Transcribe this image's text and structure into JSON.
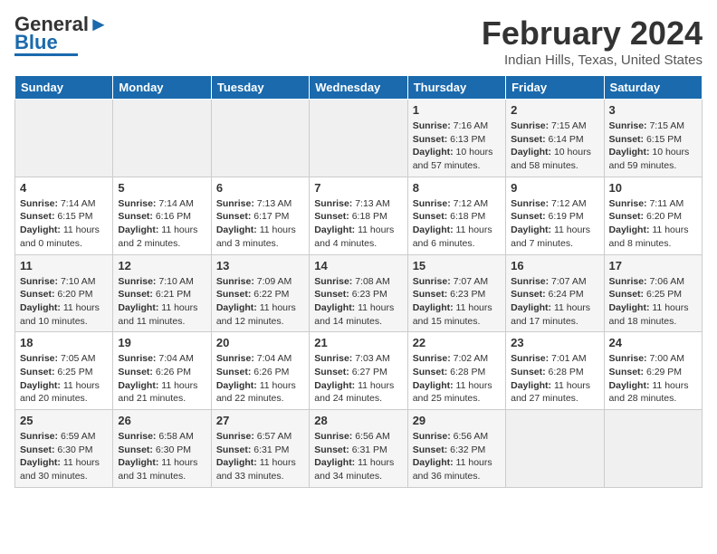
{
  "header": {
    "logo_text_general": "General",
    "logo_text_blue": "Blue",
    "title": "February 2024",
    "subtitle": "Indian Hills, Texas, United States"
  },
  "calendar": {
    "days_of_week": [
      "Sunday",
      "Monday",
      "Tuesday",
      "Wednesday",
      "Thursday",
      "Friday",
      "Saturday"
    ],
    "weeks": [
      [
        {
          "day": "",
          "content": ""
        },
        {
          "day": "",
          "content": ""
        },
        {
          "day": "",
          "content": ""
        },
        {
          "day": "",
          "content": ""
        },
        {
          "day": "1",
          "content": "Sunrise: 7:16 AM\nSunset: 6:13 PM\nDaylight: 10 hours and 57 minutes."
        },
        {
          "day": "2",
          "content": "Sunrise: 7:15 AM\nSunset: 6:14 PM\nDaylight: 10 hours and 58 minutes."
        },
        {
          "day": "3",
          "content": "Sunrise: 7:15 AM\nSunset: 6:15 PM\nDaylight: 10 hours and 59 minutes."
        }
      ],
      [
        {
          "day": "4",
          "content": "Sunrise: 7:14 AM\nSunset: 6:15 PM\nDaylight: 11 hours and 0 minutes."
        },
        {
          "day": "5",
          "content": "Sunrise: 7:14 AM\nSunset: 6:16 PM\nDaylight: 11 hours and 2 minutes."
        },
        {
          "day": "6",
          "content": "Sunrise: 7:13 AM\nSunset: 6:17 PM\nDaylight: 11 hours and 3 minutes."
        },
        {
          "day": "7",
          "content": "Sunrise: 7:13 AM\nSunset: 6:18 PM\nDaylight: 11 hours and 4 minutes."
        },
        {
          "day": "8",
          "content": "Sunrise: 7:12 AM\nSunset: 6:18 PM\nDaylight: 11 hours and 6 minutes."
        },
        {
          "day": "9",
          "content": "Sunrise: 7:12 AM\nSunset: 6:19 PM\nDaylight: 11 hours and 7 minutes."
        },
        {
          "day": "10",
          "content": "Sunrise: 7:11 AM\nSunset: 6:20 PM\nDaylight: 11 hours and 8 minutes."
        }
      ],
      [
        {
          "day": "11",
          "content": "Sunrise: 7:10 AM\nSunset: 6:20 PM\nDaylight: 11 hours and 10 minutes."
        },
        {
          "day": "12",
          "content": "Sunrise: 7:10 AM\nSunset: 6:21 PM\nDaylight: 11 hours and 11 minutes."
        },
        {
          "day": "13",
          "content": "Sunrise: 7:09 AM\nSunset: 6:22 PM\nDaylight: 11 hours and 12 minutes."
        },
        {
          "day": "14",
          "content": "Sunrise: 7:08 AM\nSunset: 6:23 PM\nDaylight: 11 hours and 14 minutes."
        },
        {
          "day": "15",
          "content": "Sunrise: 7:07 AM\nSunset: 6:23 PM\nDaylight: 11 hours and 15 minutes."
        },
        {
          "day": "16",
          "content": "Sunrise: 7:07 AM\nSunset: 6:24 PM\nDaylight: 11 hours and 17 minutes."
        },
        {
          "day": "17",
          "content": "Sunrise: 7:06 AM\nSunset: 6:25 PM\nDaylight: 11 hours and 18 minutes."
        }
      ],
      [
        {
          "day": "18",
          "content": "Sunrise: 7:05 AM\nSunset: 6:25 PM\nDaylight: 11 hours and 20 minutes."
        },
        {
          "day": "19",
          "content": "Sunrise: 7:04 AM\nSunset: 6:26 PM\nDaylight: 11 hours and 21 minutes."
        },
        {
          "day": "20",
          "content": "Sunrise: 7:04 AM\nSunset: 6:26 PM\nDaylight: 11 hours and 22 minutes."
        },
        {
          "day": "21",
          "content": "Sunrise: 7:03 AM\nSunset: 6:27 PM\nDaylight: 11 hours and 24 minutes."
        },
        {
          "day": "22",
          "content": "Sunrise: 7:02 AM\nSunset: 6:28 PM\nDaylight: 11 hours and 25 minutes."
        },
        {
          "day": "23",
          "content": "Sunrise: 7:01 AM\nSunset: 6:28 PM\nDaylight: 11 hours and 27 minutes."
        },
        {
          "day": "24",
          "content": "Sunrise: 7:00 AM\nSunset: 6:29 PM\nDaylight: 11 hours and 28 minutes."
        }
      ],
      [
        {
          "day": "25",
          "content": "Sunrise: 6:59 AM\nSunset: 6:30 PM\nDaylight: 11 hours and 30 minutes."
        },
        {
          "day": "26",
          "content": "Sunrise: 6:58 AM\nSunset: 6:30 PM\nDaylight: 11 hours and 31 minutes."
        },
        {
          "day": "27",
          "content": "Sunrise: 6:57 AM\nSunset: 6:31 PM\nDaylight: 11 hours and 33 minutes."
        },
        {
          "day": "28",
          "content": "Sunrise: 6:56 AM\nSunset: 6:31 PM\nDaylight: 11 hours and 34 minutes."
        },
        {
          "day": "29",
          "content": "Sunrise: 6:56 AM\nSunset: 6:32 PM\nDaylight: 11 hours and 36 minutes."
        },
        {
          "day": "",
          "content": ""
        },
        {
          "day": "",
          "content": ""
        }
      ]
    ]
  }
}
